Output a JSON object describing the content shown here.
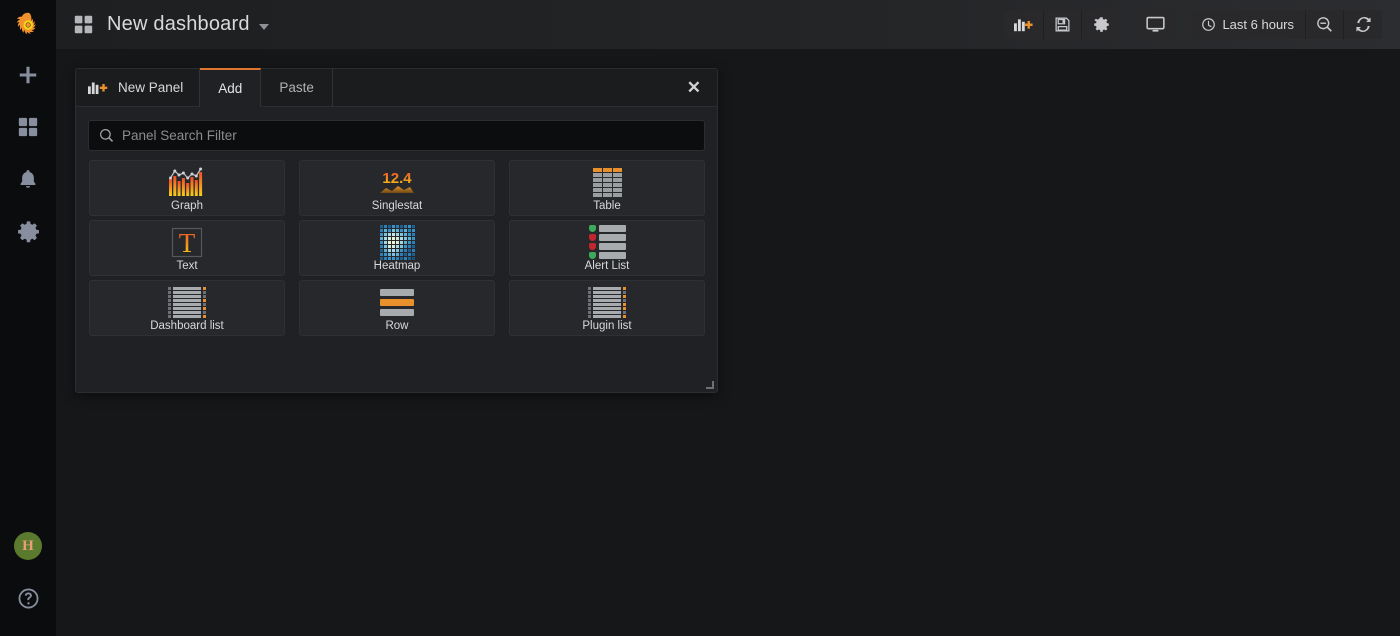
{
  "app": {
    "name": "Grafana",
    "logo_icon": "grafana-logo-icon"
  },
  "sidebar": {
    "items": [
      {
        "name": "create",
        "icon": "plus-icon",
        "label": "Create"
      },
      {
        "name": "dashboards",
        "icon": "dashboards-grid-icon",
        "label": "Dashboards"
      },
      {
        "name": "alerting",
        "icon": "bell-icon",
        "label": "Alerting"
      },
      {
        "name": "configuration",
        "icon": "gear-icon",
        "label": "Configuration"
      }
    ],
    "bottom_items": [
      {
        "name": "user-profile",
        "icon": "avatar-icon",
        "label": "H"
      },
      {
        "name": "help",
        "icon": "question-circle-icon",
        "label": "Help"
      }
    ]
  },
  "topnav": {
    "dashboard_icon": "dashboard-grid-icon",
    "title": "New dashboard",
    "caret_icon": "chevron-down-icon",
    "actions": [
      {
        "name": "add-panel-button",
        "icon": "add-panel-icon",
        "label": "Add panel"
      },
      {
        "name": "save-dashboard-button",
        "icon": "save-floppy-icon",
        "label": "Save dashboard"
      },
      {
        "name": "dashboard-settings-button",
        "icon": "gear-icon",
        "label": "Dashboard settings"
      },
      {
        "name": "tv-mode-button",
        "icon": "monitor-icon",
        "label": "Cycle view mode"
      },
      {
        "name": "time-picker-button",
        "icon": "clock-icon",
        "label": "Last 6 hours"
      },
      {
        "name": "zoom-out-button",
        "icon": "zoom-out-icon",
        "label": "Zoom out time range"
      },
      {
        "name": "refresh-button",
        "icon": "refresh-icon",
        "label": "Refresh"
      }
    ],
    "time_range": "Last 6 hours"
  },
  "add_panel": {
    "brand_icon": "add-panel-icon",
    "brand_label": "New Panel",
    "tabs": [
      {
        "name": "tab-add",
        "label": "Add",
        "active": true
      },
      {
        "name": "tab-paste",
        "label": "Paste",
        "active": false
      }
    ],
    "close_icon": "close-icon",
    "close_label": "✕",
    "search": {
      "icon": "search-icon",
      "value": "",
      "placeholder": "Panel Search Filter"
    },
    "panel_types": [
      {
        "name": "panel-type-graph",
        "label": "Graph",
        "icon": "graph-icon"
      },
      {
        "name": "panel-type-singlestat",
        "label": "Singlestat",
        "icon": "singlestat-icon",
        "value": "12.4"
      },
      {
        "name": "panel-type-table",
        "label": "Table",
        "icon": "table-icon"
      },
      {
        "name": "panel-type-text",
        "label": "Text",
        "icon": "text-icon",
        "value": "T"
      },
      {
        "name": "panel-type-heatmap",
        "label": "Heatmap",
        "icon": "heatmap-icon"
      },
      {
        "name": "panel-type-alert-list",
        "label": "Alert List",
        "icon": "alert-list-icon"
      },
      {
        "name": "panel-type-dashboard-list",
        "label": "Dashboard list",
        "icon": "dashboard-list-icon"
      },
      {
        "name": "panel-type-row",
        "label": "Row",
        "icon": "row-icon"
      },
      {
        "name": "panel-type-plugin-list",
        "label": "Plugin list",
        "icon": "plugin-list-icon"
      }
    ],
    "resize_handle": "resize-handle"
  },
  "colors": {
    "accent_orange": "#e0752d",
    "page_bg": "#161719",
    "sidebar_bg": "#0b0c0e",
    "panel_bg": "#1f2124",
    "card_bg": "#26282b",
    "text_primary": "#d8d9da",
    "alert_ok": "#3ea95a",
    "alert_critical": "#c4262e",
    "heatmap_blue": "#2a7fb8"
  }
}
